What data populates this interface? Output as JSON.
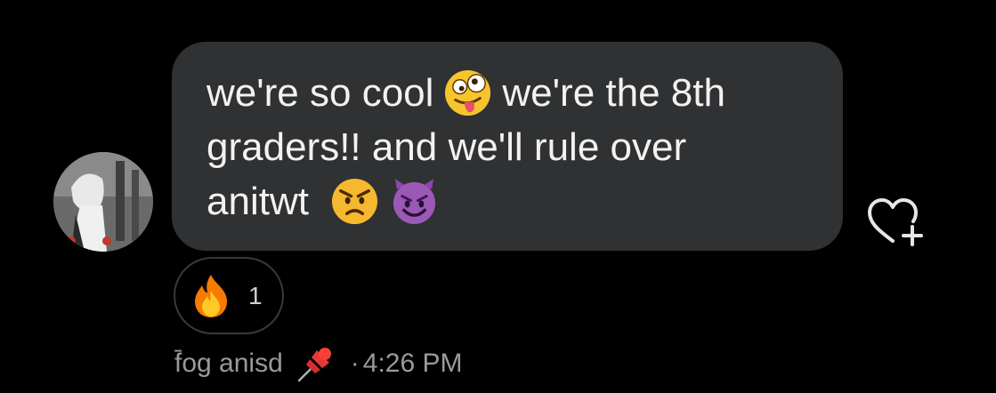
{
  "message": {
    "lines": [
      {
        "before": "we're so cool",
        "emoji": "zany-face-emoji",
        "after": "we're the 8th"
      },
      {
        "text": "graders!! and we'll rule over"
      },
      {
        "before": "anitwt",
        "emoji": "angry-face-emoji",
        "emoji2": "smiling-devil-emoji"
      }
    ]
  },
  "reaction": {
    "emoji": "fire-emoji",
    "count": "1"
  },
  "meta": {
    "sender": "f̄og anisd",
    "pin_emoji": "pushpin-emoji",
    "separator": "·",
    "time": "4:26 PM"
  },
  "actions": {
    "like_icon": "heart-plus-icon"
  },
  "colors": {
    "background": "#000000",
    "bubble": "#2f3133",
    "text": "#f2f2f2",
    "meta_text": "#9a9a9a"
  }
}
